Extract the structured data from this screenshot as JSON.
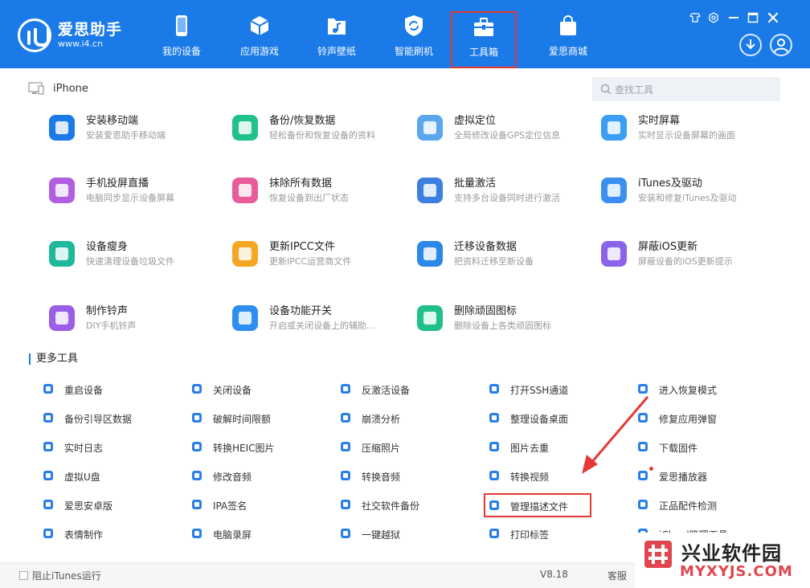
{
  "header": {
    "logo_name": "爱思助手",
    "logo_url": "www.i4.cn",
    "nav": [
      {
        "label": "我的设备",
        "icon": "phone-icon"
      },
      {
        "label": "应用游戏",
        "icon": "cube-icon"
      },
      {
        "label": "铃声壁纸",
        "icon": "music-folder-icon"
      },
      {
        "label": "智能刷机",
        "icon": "refresh-shield-icon"
      },
      {
        "label": "工具箱",
        "icon": "toolbox-icon",
        "active": true
      },
      {
        "label": "爱思商城",
        "icon": "shopping-bag-icon"
      }
    ],
    "window_controls": [
      "skin-icon",
      "settings-icon",
      "minimize-icon",
      "maximize-icon",
      "close-icon"
    ]
  },
  "subheader": {
    "device_name": "iPhone",
    "search_placeholder": "查找工具"
  },
  "tools": [
    {
      "name": "安装移动端",
      "desc": "安装爱思助手移动端",
      "icon": "i4-app-icon",
      "color": "#1a7ae8"
    },
    {
      "name": "备份/恢复数据",
      "desc": "轻松备份和恢复设备的资料",
      "icon": "layers-icon",
      "color": "#21c18c"
    },
    {
      "name": "虚拟定位",
      "desc": "全局修改设备GPS定位信息",
      "icon": "map-icon",
      "color": "#5aa7f0"
    },
    {
      "name": "实时屏幕",
      "desc": "实时显示设备屏幕的画面",
      "icon": "screen-icon",
      "color": "#3a9ef5"
    },
    {
      "name": "手机投屏直播",
      "desc": "电脑同步显示设备屏幕",
      "icon": "cast-icon",
      "color": "#b05fe0"
    },
    {
      "name": "抹除所有数据",
      "desc": "恢复设备到出厂状态",
      "icon": "eraser-icon",
      "color": "#e95c9c"
    },
    {
      "name": "批量激活",
      "desc": "支持多台设备同时进行激活",
      "icon": "batch-activate-icon",
      "color": "#3b7fe0"
    },
    {
      "name": "iTunes及驱动",
      "desc": "安装和修复iTunes及驱动",
      "icon": "music-note-icon",
      "color": "#3a8ff0"
    },
    {
      "name": "设备瘦身",
      "desc": "快速清理设备垃圾文件",
      "icon": "broom-icon",
      "color": "#1fb89a"
    },
    {
      "name": "更新IPCC文件",
      "desc": "更新IPCC运营商文件",
      "icon": "ipcc-folder-icon",
      "color": "#f5a623"
    },
    {
      "name": "迁移设备数据",
      "desc": "把资料迁移至新设备",
      "icon": "migrate-icon",
      "color": "#2b88e8"
    },
    {
      "name": "屏蔽iOS更新",
      "desc": "屏蔽设备的iOS更新提示",
      "icon": "block-update-icon",
      "color": "#8a63e8"
    },
    {
      "name": "制作铃声",
      "desc": "DIY手机铃声",
      "icon": "ringtone-icon",
      "color": "#9a5fe6"
    },
    {
      "name": "设备功能开关",
      "desc": "开启或关闭设备上的辅助...",
      "icon": "sliders-icon",
      "color": "#2d8ef0"
    },
    {
      "name": "删除顽固图标",
      "desc": "删除设备上各类顽固图标",
      "icon": "trash-icon",
      "color": "#20c08a"
    }
  ],
  "more_tools_title": "更多工具",
  "more_tools": [
    {
      "name": "重启设备",
      "icon": "restart-icon"
    },
    {
      "name": "关闭设备",
      "icon": "power-icon"
    },
    {
      "name": "反激活设备",
      "icon": "deactivate-icon"
    },
    {
      "name": "打开SSH通道",
      "icon": "ssh-icon"
    },
    {
      "name": "进入恢复模式",
      "icon": "recovery-icon"
    },
    {
      "name": "备份引导区数据",
      "icon": "backup-boot-icon"
    },
    {
      "name": "破解时间限额",
      "icon": "clock-icon"
    },
    {
      "name": "崩溃分析",
      "icon": "chart-icon"
    },
    {
      "name": "整理设备桌面",
      "icon": "desktop-grid-icon"
    },
    {
      "name": "修复应用弹窗",
      "icon": "repair-popup-icon"
    },
    {
      "name": "实时日志",
      "icon": "log-icon"
    },
    {
      "name": "转换HEIC图片",
      "icon": "heic-convert-icon"
    },
    {
      "name": "压缩照片",
      "icon": "photo-compress-icon"
    },
    {
      "name": "图片去重",
      "icon": "image-dedupe-icon"
    },
    {
      "name": "下载固件",
      "icon": "firmware-download-icon"
    },
    {
      "name": "虚拟U盘",
      "icon": "usb-drive-icon"
    },
    {
      "name": "修改音频",
      "icon": "audio-edit-icon"
    },
    {
      "name": "转换音频",
      "icon": "audio-convert-icon"
    },
    {
      "name": "转换视频",
      "icon": "video-convert-icon"
    },
    {
      "name": "爱思播放器",
      "icon": "player-icon"
    },
    {
      "name": "爱思安卓版",
      "icon": "i4-android-icon"
    },
    {
      "name": "IPA签名",
      "icon": "ipa-sign-icon"
    },
    {
      "name": "社交软件备份",
      "icon": "social-backup-icon"
    },
    {
      "name": "管理描述文件",
      "icon": "profile-manage-icon",
      "highlight": true
    },
    {
      "name": "正品配件检测",
      "icon": "accessory-check-icon"
    },
    {
      "name": "表情制作",
      "icon": "emoji-icon"
    },
    {
      "name": "电脑录屏",
      "icon": "record-icon"
    },
    {
      "name": "一键越狱",
      "icon": "unlock-icon"
    },
    {
      "name": "打印标签",
      "icon": "printer-icon"
    },
    {
      "name": "iCloud管理工具",
      "icon": "icloud-icon"
    }
  ],
  "footer": {
    "block_itunes": "阻止iTunes运行",
    "version": "V8.18",
    "service": "客服"
  },
  "watermark": {
    "title": "兴业软件园",
    "url": "MYXYJS.COM"
  },
  "colors": {
    "header_blue": "#1a7ae8",
    "highlight_red": "#e53935",
    "accent_blue": "#1a7ae8"
  }
}
